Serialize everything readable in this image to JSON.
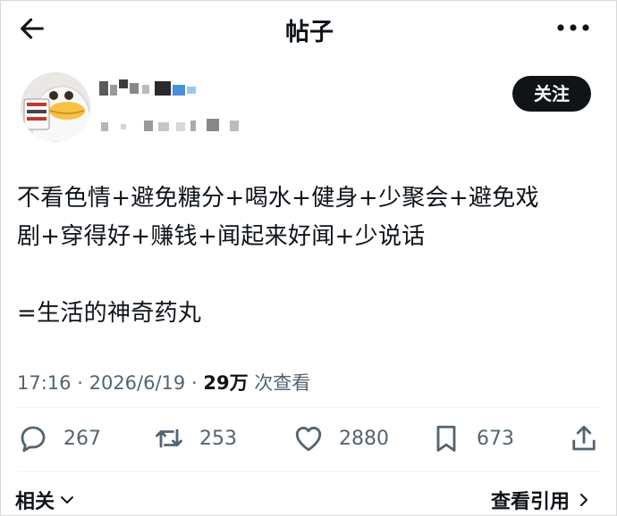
{
  "header": {
    "title": "帖子",
    "back_icon": "arrow-left-icon",
    "more_icon": "more-horizontal-icon"
  },
  "author": {
    "follow_label": "关注",
    "avatar_icon": "cartoon-duck-avatar"
  },
  "post": {
    "lines": [
      "不看色情+避免糖分+喝水+健身+少聚会+避免戏",
      "剧+穿得好+赚钱+闻起来好闻+少说话",
      "",
      "=生活的神奇药丸"
    ]
  },
  "meta": {
    "time": "17:16",
    "separator": "·",
    "date": "2026/6/19",
    "views": "29万",
    "views_suffix": "次查看"
  },
  "actions": {
    "replies": "267",
    "reposts": "253",
    "likes": "2880",
    "bookmarks": "673"
  },
  "footer": {
    "related_label": "相关",
    "quotes_label": "查看引用"
  },
  "colors": {
    "text": "#0f1419",
    "secondary": "#536471",
    "button_bg": "#0f1419"
  }
}
